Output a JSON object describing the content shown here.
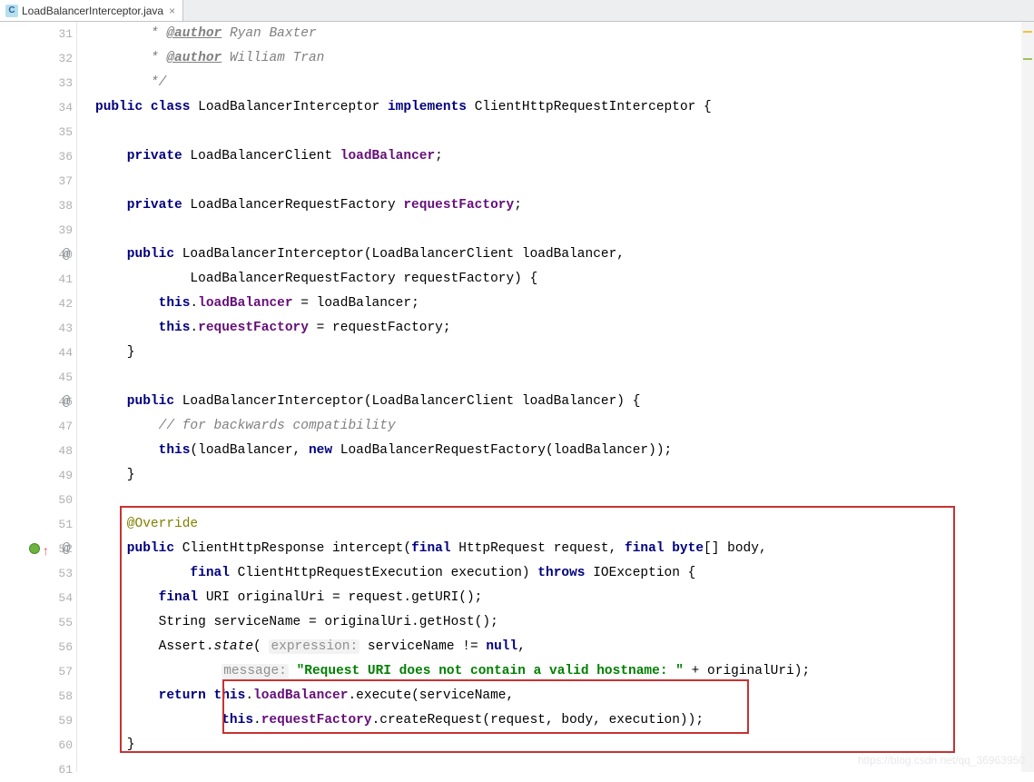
{
  "tab": {
    "icon_letter": "C",
    "filename": "LoadBalancerInterceptor.java",
    "close": "×"
  },
  "line_numbers": [
    "31",
    "32",
    "33",
    "34",
    "35",
    "36",
    "37",
    "38",
    "39",
    "40",
    "41",
    "42",
    "43",
    "44",
    "45",
    "46",
    "47",
    "48",
    "49",
    "50",
    "51",
    "52",
    "53",
    "54",
    "55",
    "56",
    "57",
    "58",
    "59",
    "60",
    "61"
  ],
  "gutter": {
    "at_mark": "@",
    "status_present_on": 52,
    "arrow_up": "↑"
  },
  "code": {
    "l31_pre": "       * ",
    "l31_tag": "@author",
    "l31_txt": " Ryan Baxter",
    "l32_pre": "       * ",
    "l32_tag": "@author",
    "l32_txt": " William Tran",
    "l33": "       */",
    "l34a": "public",
    "l34b": " class",
    "l34c": " LoadBalancerInterceptor ",
    "l34d": "implements",
    "l34e": " ClientHttpRequestInterceptor {",
    "l35": "",
    "l36a": "    private",
    "l36b": " LoadBalancerClient ",
    "l36c": "loadBalancer",
    "l36d": ";",
    "l37": "",
    "l38a": "    private",
    "l38b": " LoadBalancerRequestFactory ",
    "l38c": "requestFactory",
    "l38d": ";",
    "l39": "",
    "l40a": "    public",
    "l40b": " LoadBalancerInterceptor(LoadBalancerClient loadBalancer,",
    "l41": "            LoadBalancerRequestFactory requestFactory) {",
    "l42a": "        this",
    "l42b": ".",
    "l42c": "loadBalancer",
    "l42d": " = loadBalancer;",
    "l43a": "        this",
    "l43b": ".",
    "l43c": "requestFactory",
    "l43d": " = requestFactory;",
    "l44": "    }",
    "l45": "",
    "l46a": "    public",
    "l46b": " LoadBalancerInterceptor(LoadBalancerClient loadBalancer) {",
    "l47": "        // for backwards compatibility",
    "l48a": "        this",
    "l48b": "(loadBalancer, ",
    "l48c": "new",
    "l48d": " LoadBalancerRequestFactory(loadBalancer));",
    "l49": "    }",
    "l50": "",
    "l51": "    @Override",
    "l52a": "    public",
    "l52b": " ClientHttpResponse intercept(",
    "l52c": "final",
    "l52d": " HttpRequest request, ",
    "l52e": "final",
    "l52f": " byte",
    "l52g": "[] body,",
    "l53a": "            final",
    "l53b": " ClientHttpRequestExecution execution) ",
    "l53c": "throws",
    "l53d": " IOException {",
    "l54a": "        final",
    "l54b": " URI originalUri = request.getURI();",
    "l55": "        String serviceName = originalUri.getHost();",
    "l56a": "        Assert.",
    "l56b": "state",
    "l56c": "( ",
    "l56hint1": "expression:",
    "l56d": " serviceName != ",
    "l56e": "null",
    "l56f": ",",
    "l57a": "                ",
    "l57hint": "message:",
    "l57b": " ",
    "l57str": "\"Request URI does not contain a valid hostname: \"",
    "l57c": " + originalUri);",
    "l58a": "        return",
    "l58b": " ",
    "l58c": "this",
    "l58d": ".",
    "l58e": "loadBalancer",
    "l58f": ".execute(serviceName,",
    "l59a": "                this",
    "l59b": ".",
    "l59c": "requestFactory",
    "l59d": ".createRequest(request, body, execution));",
    "l60": "    }",
    "l61": ""
  },
  "watermark": "https://blog.csdn.net/qq_36963950"
}
